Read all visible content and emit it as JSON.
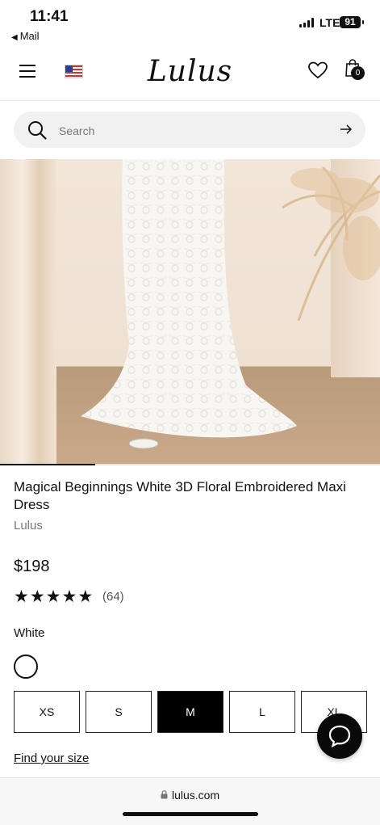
{
  "status_bar": {
    "time": "11:41",
    "back_app": "Mail",
    "network": "LTE",
    "battery": "91"
  },
  "header": {
    "logo": "Lulus",
    "cart_count": "0"
  },
  "search": {
    "placeholder": "Search"
  },
  "gallery": {
    "progress_fraction": 0.25
  },
  "product": {
    "title": "Magical Beginnings White 3D Floral Embroidered Maxi Dress",
    "brand": "Lulus",
    "price": "$198",
    "rating": 5,
    "review_count": "(64)",
    "color_name": "White",
    "sizes": [
      "XS",
      "S",
      "M",
      "L",
      "XL"
    ],
    "selected_size": "M",
    "find_size_link": "Find your size"
  },
  "browser": {
    "url": "lulus.com"
  },
  "colors": {
    "accent": "#000000",
    "text": "#111111",
    "muted": "#777777"
  }
}
